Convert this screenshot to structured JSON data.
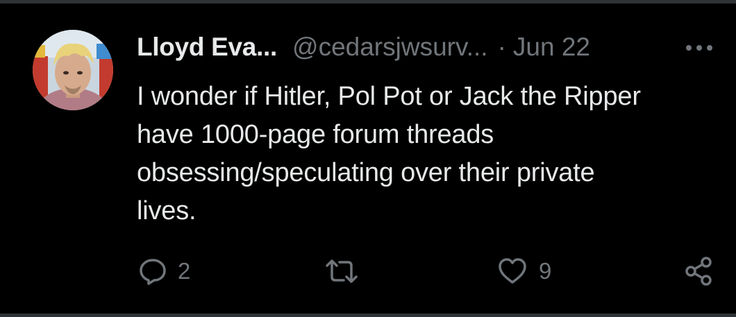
{
  "tweet": {
    "author_name": "Lloyd Eva...",
    "author_handle": "@cedarsjwsurv...",
    "separator": "·",
    "date": "Jun 22",
    "text": "I wonder if Hitler, Pol Pot or Jack the Ripper\nhave 1000-page forum threads\nobsessing/speculating over their private\nlives."
  },
  "actions": {
    "reply": {
      "icon": "reply-icon",
      "count": "2"
    },
    "retweet": {
      "icon": "retweet-icon",
      "count": ""
    },
    "like": {
      "icon": "heart-icon",
      "count": "9"
    },
    "share": {
      "icon": "share-icon"
    },
    "more": {
      "icon": "more-dots-icon"
    }
  },
  "colors": {
    "background": "#000000",
    "text_primary": "#e7e9ea",
    "text_secondary": "#71767b",
    "divider": "#2f3336"
  }
}
